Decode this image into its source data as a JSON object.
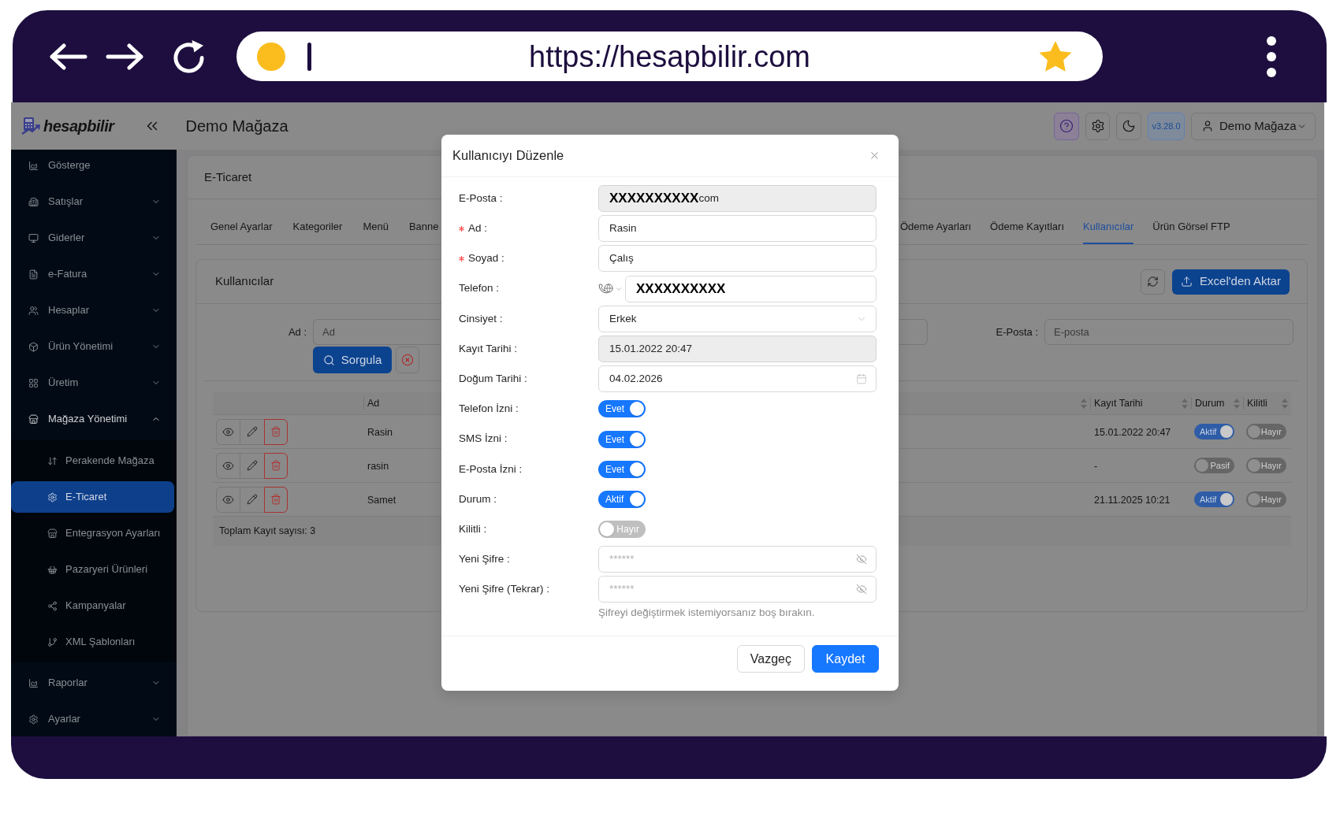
{
  "browser": {
    "url": "https://hesapbilir.com",
    "bookmarked": true
  },
  "header": {
    "logo": "hesapbilir",
    "title": "Demo Mağaza",
    "version": "v3.28.0",
    "user": "Demo Mağaza"
  },
  "sidebar": {
    "items": [
      {
        "label": "Gösterge",
        "kind": "link",
        "selected": false
      },
      {
        "label": "Satışlar",
        "kind": "group",
        "expanded": false,
        "selected": false
      },
      {
        "label": "Giderler",
        "kind": "group",
        "expanded": false,
        "selected": false
      },
      {
        "label": "e-Fatura",
        "kind": "group",
        "expanded": false,
        "selected": false
      },
      {
        "label": "Hesaplar",
        "kind": "group",
        "expanded": false,
        "selected": false
      },
      {
        "label": "Ürün Yönetimi",
        "kind": "group",
        "expanded": false,
        "selected": false
      },
      {
        "label": "Üretim",
        "kind": "group",
        "expanded": false,
        "selected": false
      },
      {
        "label": "Mağaza Yönetimi",
        "kind": "group",
        "expanded": true,
        "selected": false,
        "children": [
          {
            "label": "Perakende Mağaza",
            "selected": false
          },
          {
            "label": "E-Ticaret",
            "selected": true
          },
          {
            "label": "Entegrasyon Ayarları",
            "selected": false
          },
          {
            "label": "Pazaryeri Ürünleri",
            "selected": false
          },
          {
            "label": "Kampanyalar",
            "selected": false
          },
          {
            "label": "XML Şablonları",
            "selected": false
          }
        ]
      },
      {
        "label": "Raporlar",
        "kind": "group",
        "expanded": false,
        "selected": false
      },
      {
        "label": "Ayarlar",
        "kind": "group",
        "expanded": false,
        "selected": false
      }
    ]
  },
  "page": {
    "title": "E-Ticaret",
    "tabs": [
      {
        "label": "Genel Ayarlar",
        "selected": false
      },
      {
        "label": "Kategoriler",
        "selected": false
      },
      {
        "label": "Menü",
        "selected": false
      },
      {
        "label": "Banne",
        "selected": false
      },
      {
        "label": "Ödeme Ayarları",
        "selected": false
      },
      {
        "label": "Ödeme Kayıtları",
        "selected": false
      },
      {
        "label": "Kullanıcılar",
        "selected": true
      },
      {
        "label": "Ürün Görsel FTP",
        "selected": false
      }
    ],
    "users": {
      "title": "Kullanıcılar",
      "import_button": "Excel'den Aktar",
      "filters": [
        {
          "label": "Ad :",
          "placeholder": "Ad"
        },
        {
          "label": "E-Posta :",
          "placeholder": "E-posta"
        }
      ],
      "search_button": "Sorgula",
      "table": {
        "columns": [
          {
            "label": "Ad",
            "sortable": false
          },
          {
            "sortable": true
          },
          {
            "label": "Kayıt Tarihi",
            "sortable": true
          },
          {
            "label": "Durum",
            "sortable": true
          },
          {
            "label": "Kilitli",
            "sortable": true
          }
        ],
        "rows": [
          {
            "name": "Rasin",
            "registered": "15.01.2022 20:47",
            "status": {
              "label": "Aktif",
              "on": true
            },
            "locked": {
              "label": "Hayır",
              "on": false
            }
          },
          {
            "name": "rasin",
            "registered": "-",
            "status": {
              "label": "Pasif",
              "on": false
            },
            "locked": {
              "label": "Hayır",
              "on": false
            }
          },
          {
            "name": "Samet",
            "registered": "21.11.2025 10:21",
            "status": {
              "label": "Aktif",
              "on": true
            },
            "locked": {
              "label": "Hayır",
              "on": false
            }
          }
        ],
        "total": "Toplam Kayıt sayısı: 3"
      }
    }
  },
  "modal": {
    "title": "Kullanıcıyı Düzenle",
    "fields": [
      {
        "kind": "text",
        "label": "E-Posta :",
        "required": false,
        "disabled": true,
        "redaction": "XXXXXXXXXX",
        "value": "com"
      },
      {
        "kind": "text",
        "label": "Ad :",
        "required": true,
        "disabled": false,
        "value": "Rasin"
      },
      {
        "kind": "text",
        "label": "Soyad :",
        "required": true,
        "disabled": false,
        "value": "Çalış"
      },
      {
        "kind": "phone",
        "label": "Telefon :",
        "required": false,
        "disabled": false,
        "redaction": "XXXXXXXXXX"
      },
      {
        "kind": "select",
        "label": "Cinsiyet :",
        "required": false,
        "disabled": false,
        "value": "Erkek"
      },
      {
        "kind": "text",
        "label": "Kayıt Tarihi :",
        "required": false,
        "disabled": true,
        "value": "15.01.2022 20:47"
      },
      {
        "kind": "date",
        "label": "Doğum Tarihi :",
        "required": false,
        "disabled": false,
        "value": "04.02.2026"
      },
      {
        "kind": "switch",
        "label": "Telefon İzni :",
        "required": false,
        "on": true,
        "text": "Evet"
      },
      {
        "kind": "switch",
        "label": "SMS İzni :",
        "required": false,
        "on": true,
        "text": "Evet"
      },
      {
        "kind": "switch",
        "label": "E-Posta İzni :",
        "required": false,
        "on": true,
        "text": "Evet"
      },
      {
        "kind": "switch",
        "label": "Durum :",
        "required": false,
        "on": true,
        "text": "Aktif"
      },
      {
        "kind": "switch",
        "label": "Kilitli :",
        "required": false,
        "on": false,
        "text": "Hayır"
      },
      {
        "kind": "password",
        "label": "Yeni Şifre :",
        "required": false,
        "disabled": false,
        "placeholder": "******"
      },
      {
        "kind": "password",
        "label": "Yeni Şifre (Tekrar) :",
        "required": false,
        "disabled": false,
        "placeholder": "******"
      }
    ],
    "hint": "Şifreyi değiştirmek istemiyorsanız boş bırakın.",
    "buttons": [
      {
        "label": "Vazgeç",
        "kind": "default"
      },
      {
        "label": "Kaydet",
        "kind": "primary"
      }
    ]
  }
}
